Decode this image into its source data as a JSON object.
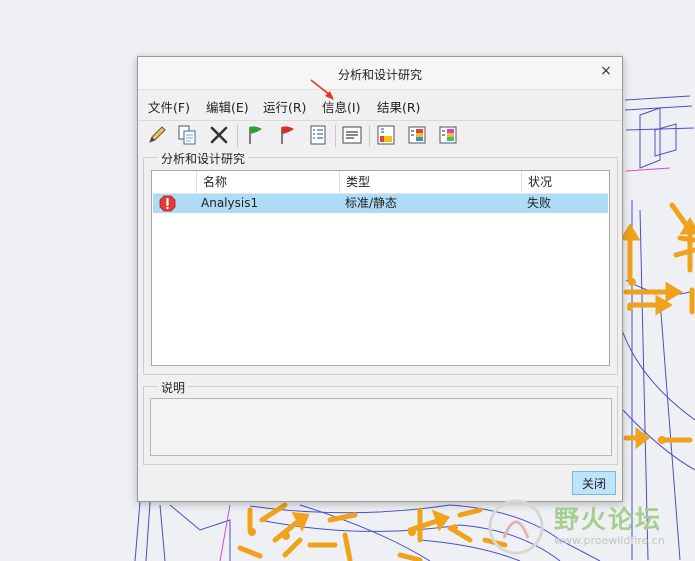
{
  "dialog": {
    "title": "分析和设计研究",
    "close_glyph": "×"
  },
  "menu": [
    {
      "label": "文件(F)"
    },
    {
      "label": "编辑(E)"
    },
    {
      "label": "运行(R)"
    },
    {
      "label": "信息(I)"
    },
    {
      "label": "结果(R)"
    }
  ],
  "toolbar": {
    "icons": [
      "pencil-icon",
      "copy-icon",
      "delete-icon",
      "green-flag-icon",
      "red-flag-icon",
      "checklist-icon",
      "info-panel-icon",
      "results-icon",
      "results-compare-icon",
      "results-report-icon"
    ]
  },
  "studies_group": {
    "legend": "分析和设计研究",
    "columns": [
      "名称",
      "类型",
      "状况"
    ],
    "rows": [
      {
        "status_icon": "error-icon",
        "name": "Analysis1",
        "type": "标准/静态",
        "state": "失败"
      }
    ]
  },
  "description_group": {
    "legend": "说明",
    "text": ""
  },
  "close_button": {
    "label": "关闭"
  },
  "watermark": {
    "text": "野火论坛",
    "sub": "www.proewildfire.cn"
  },
  "colors": {
    "selection": "#aedcf7",
    "close_button_bg": "#bfe4fa",
    "wireframe": "#4a50c8",
    "arrow": "#f0a21a",
    "error": "#e53935"
  }
}
